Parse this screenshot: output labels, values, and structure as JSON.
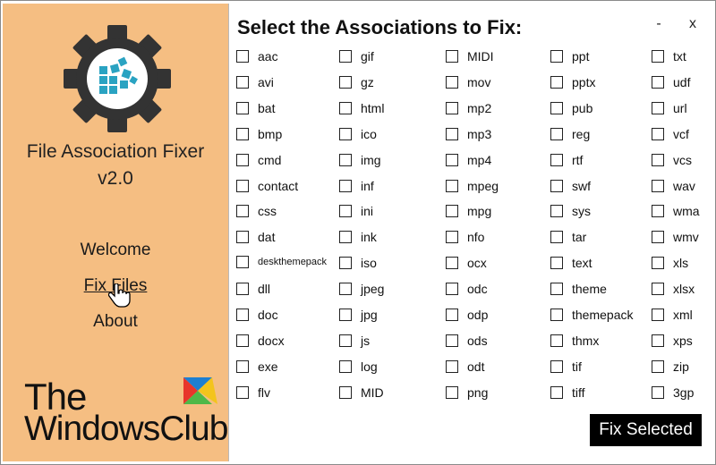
{
  "sidebar": {
    "app_title": "File Association Fixer",
    "version": "v2.0",
    "nav": {
      "welcome": "Welcome",
      "fix_files": "Fix Files",
      "about": "About"
    },
    "brand_line1": "The",
    "brand_line2": "WindowsClub",
    "logo_icon": "gear-with-blocks-icon",
    "colors": {
      "sidebar_bg": "#f5be82",
      "gear": "#333333",
      "blocks": "#2aa3c2"
    }
  },
  "main": {
    "heading": "Select the Associations to Fix:",
    "minimize_label": "-",
    "close_label": "x",
    "fix_button": "Fix Selected",
    "columns": [
      [
        "aac",
        "avi",
        "bat",
        "bmp",
        "cmd",
        "contact",
        "css",
        "dat",
        "deskthemepack",
        "dll",
        "doc",
        "docx",
        "exe",
        "flv"
      ],
      [
        "gif",
        "gz",
        "html",
        "ico",
        "img",
        "inf",
        "ini",
        "ink",
        "iso",
        "jpeg",
        "jpg",
        "js",
        "log",
        "MID"
      ],
      [
        "MIDI",
        "mov",
        "mp2",
        "mp3",
        "mp4",
        "mpeg",
        "mpg",
        "nfo",
        "ocx",
        "odc",
        "odp",
        "ods",
        "odt",
        "png"
      ],
      [
        "ppt",
        "pptx",
        "pub",
        "reg",
        "rtf",
        "swf",
        "sys",
        "tar",
        "text",
        "theme",
        "themepack",
        "thmx",
        "tif",
        "tiff"
      ],
      [
        "txt",
        "udf",
        "url",
        "vcf",
        "vcs",
        "wav",
        "wma",
        "wmv",
        "xls",
        "xlsx",
        "xml",
        "xps",
        "zip",
        "3gp"
      ]
    ]
  }
}
